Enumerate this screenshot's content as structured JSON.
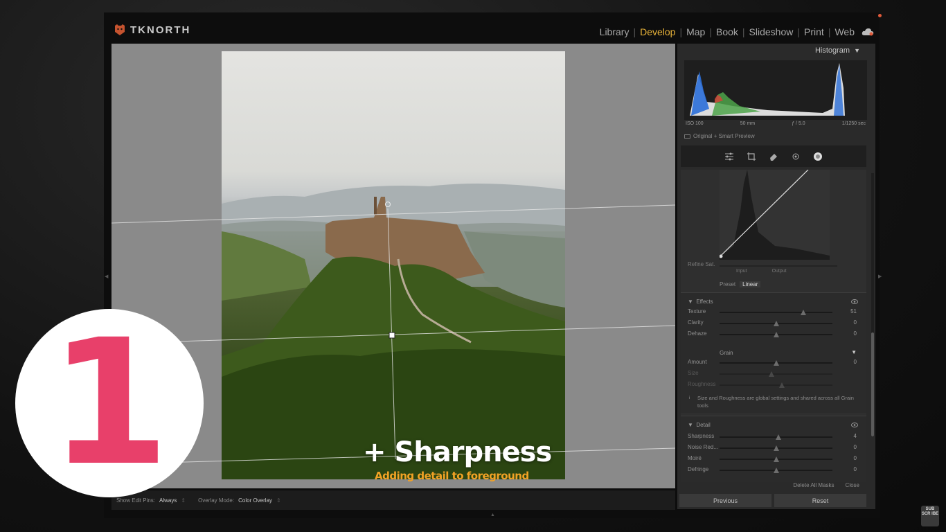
{
  "brand": {
    "name": "TKNORTH"
  },
  "modules": [
    {
      "label": "Library",
      "active": false
    },
    {
      "label": "Develop",
      "active": true
    },
    {
      "label": "Map",
      "active": false
    },
    {
      "label": "Book",
      "active": false
    },
    {
      "label": "Slideshow",
      "active": false
    },
    {
      "label": "Print",
      "active": false
    },
    {
      "label": "Web",
      "active": false
    }
  ],
  "panel": {
    "title": "Histogram",
    "histogram_meta": {
      "iso": "ISO 100",
      "focal": "50 mm",
      "aperture": "ƒ / 5.0",
      "shutter": "1/1250 sec"
    },
    "smart_preview": "Original + Smart Preview",
    "curve": {
      "refine_label": "Refine Sat.",
      "input_label": "Input",
      "output_label": "Output",
      "preset_label": "Preset",
      "preset_value": "Linear"
    },
    "effects": {
      "header": "Effects",
      "sliders": [
        {
          "label": "Texture",
          "value": "51",
          "fraction": 0.74
        },
        {
          "label": "Clarity",
          "value": "0",
          "fraction": 0.5
        },
        {
          "label": "Dehaze",
          "value": "0",
          "fraction": 0.5
        }
      ],
      "grain_header": "Grain",
      "grain_sliders": [
        {
          "label": "Amount",
          "value": "0",
          "fraction": 0.5
        },
        {
          "label": "Size",
          "value": "",
          "fraction": 0.46
        },
        {
          "label": "Roughness",
          "value": "",
          "fraction": 0.55
        }
      ],
      "grain_note": "Size and Roughness are global settings and shared across all Grain tools"
    },
    "detail": {
      "header": "Detail",
      "sliders": [
        {
          "label": "Sharpness",
          "value": "4",
          "fraction": 0.52
        },
        {
          "label": "Noise Red...",
          "value": "0",
          "fraction": 0.5
        },
        {
          "label": "Moiré",
          "value": "0",
          "fraction": 0.5
        },
        {
          "label": "Defringe",
          "value": "0",
          "fraction": 0.5
        }
      ]
    },
    "delete_all_masks": "Delete All Masks",
    "close": "Close",
    "previous": "Previous",
    "reset": "Reset"
  },
  "toolbar": {
    "show_edit_pins_label": "Show Edit Pins:",
    "show_edit_pins_value": "Always",
    "overlay_mode_label": "Overlay Mode:",
    "overlay_mode_value": "Color Overlay"
  },
  "overlay": {
    "number": "1",
    "caption": "+ Sharpness",
    "subcaption": "Adding detail to foreground",
    "subscribe": "SUB SCR IBE",
    "colors": {
      "number": "#e8406a",
      "subcaption": "#f2a225",
      "accent": "#e8b339"
    }
  }
}
